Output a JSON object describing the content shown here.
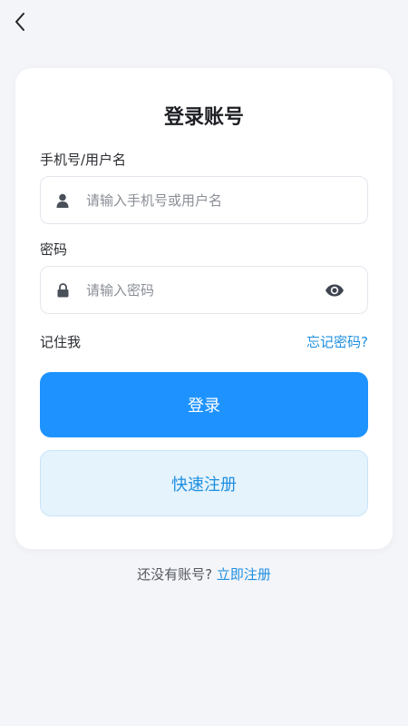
{
  "nav": {
    "back_icon": "chevron-left-icon"
  },
  "card": {
    "title": "登录账号",
    "username": {
      "label": "手机号/用户名",
      "placeholder": "请输入手机号或用户名",
      "value": "",
      "icon": "user-icon"
    },
    "password": {
      "label": "密码",
      "placeholder": "请输入密码",
      "value": "",
      "icon": "lock-icon",
      "toggle_icon": "eye-icon"
    },
    "remember_label": "记住我",
    "forgot_label": "忘记密码?",
    "login_label": "登录",
    "quick_register_label": "快速注册"
  },
  "footer": {
    "prompt": "还没有账号?",
    "link": "立即注册"
  },
  "colors": {
    "primary": "#1e93ff",
    "link": "#1e8fe0",
    "background": "#f4f5f9",
    "quick_bg": "#e5f3fd"
  }
}
